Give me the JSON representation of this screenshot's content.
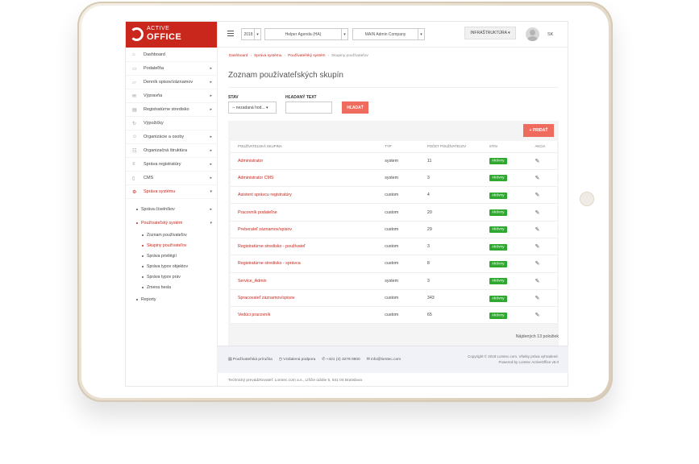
{
  "logo": {
    "small": "ACTIVE",
    "big": "OFFICE"
  },
  "sidebar": {
    "items": [
      {
        "label": "Dashboard",
        "icon": "home-icon",
        "has_children": false
      },
      {
        "label": "Podateľňa",
        "icon": "inbox-icon",
        "has_children": true
      },
      {
        "label": "Denník spisov/záznamov",
        "icon": "folder-icon",
        "has_children": true
      },
      {
        "label": "Výpravňa",
        "icon": "mail-icon",
        "has_children": true
      },
      {
        "label": "Registratúrne stredisko",
        "icon": "archive-icon",
        "has_children": true
      },
      {
        "label": "Výpožičky",
        "icon": "refresh-icon",
        "has_children": false
      },
      {
        "label": "Organizácie a osoby",
        "icon": "users-icon",
        "has_children": true
      },
      {
        "label": "Organizačná štruktúra",
        "icon": "sitemap-icon",
        "has_children": true
      },
      {
        "label": "Správa registratúry",
        "icon": "list-icon",
        "has_children": true
      },
      {
        "label": "CMS",
        "icon": "document-icon",
        "has_children": true
      },
      {
        "label": "Správa systému",
        "icon": "gears-icon",
        "has_children": true
      }
    ],
    "sub_items": [
      {
        "label": "Správa číselníkov"
      },
      {
        "label": "Používateľský systém"
      }
    ],
    "subsub_items": [
      {
        "label": "Zoznam používateľov"
      },
      {
        "label": "Skupiny používateľov"
      },
      {
        "label": "Správa privilégií"
      },
      {
        "label": "Správa typov objektov"
      },
      {
        "label": "Správa typov práv"
      },
      {
        "label": "Zmena hesla"
      }
    ],
    "reporty": "Reporty"
  },
  "topbar": {
    "year": "2018",
    "agenda": "Helper Agenda (HA)",
    "company": "MAIN Admin Company",
    "infra": "INFRAŠTRUKTÚRA ▾",
    "lang": "SK"
  },
  "breadcrumb": [
    "Dashboard",
    "Správa systému",
    "Používateľský systém",
    "Skupiny používateľov"
  ],
  "page": {
    "title": "Zoznam používateľských skupín",
    "filter_stav_label": "STAV",
    "filter_stav_value": "-- nezadaná hod... ▾",
    "filter_text_label": "HĽADANÝ TEXT",
    "search_placeholder": "",
    "btn_search": "HĽADAŤ",
    "btn_add": "+ PRIDAŤ",
    "found": "Nájdených 13 položiek"
  },
  "table": {
    "headers": [
      "POUŽÍVATEĽSKÁ SKUPINA",
      "TYP",
      "POČET POUŽÍVATEĽOV",
      "STAV",
      "AKCIA"
    ],
    "rows": [
      {
        "name": "Administrator",
        "type": "system",
        "count": "11",
        "status": "Aktívny"
      },
      {
        "name": "Administrator CMS",
        "type": "system",
        "count": "3",
        "status": "Aktívny"
      },
      {
        "name": "Asistent správcu registratúry",
        "type": "custom",
        "count": "4",
        "status": "Aktívny"
      },
      {
        "name": "Pracovník podateľne",
        "type": "custom",
        "count": "20",
        "status": "Aktívny"
      },
      {
        "name": "Preberateľ záznamov/spisov",
        "type": "custom",
        "count": "29",
        "status": "Aktívny"
      },
      {
        "name": "Registratúrne stredisko - používateľ",
        "type": "custom",
        "count": "3",
        "status": "Aktívny"
      },
      {
        "name": "Registratúrne stredisko - správca",
        "type": "custom",
        "count": "8",
        "status": "Aktívny"
      },
      {
        "name": "Service_Admin",
        "type": "system",
        "count": "3",
        "status": "Aktívny"
      },
      {
        "name": "Spracovateľ záznamov/spisov",
        "type": "custom",
        "count": "343",
        "status": "Aktívny"
      },
      {
        "name": "Vedúci pracovník",
        "type": "custom",
        "count": "65",
        "status": "Aktívny"
      }
    ]
  },
  "footer": {
    "links": [
      "Používateľská príručka",
      "Vzdialená podpora",
      "+421 (2) 3278 0800",
      "info@lomtec.com"
    ],
    "copyright_1": "Copyright © 2018 Lomtec.com. Všetky práva vyhradené.",
    "copyright_2": "Powered by Lomtec ActiveOffice v6.0",
    "provider": "Technický prevádzkovateľ: Lomtec.com a.s., Líščie údolie 5, 841 04 Bratislava"
  },
  "colors": {
    "accent": "#c9261c",
    "button": "#ee6b5d",
    "badge": "#2ea82e"
  }
}
